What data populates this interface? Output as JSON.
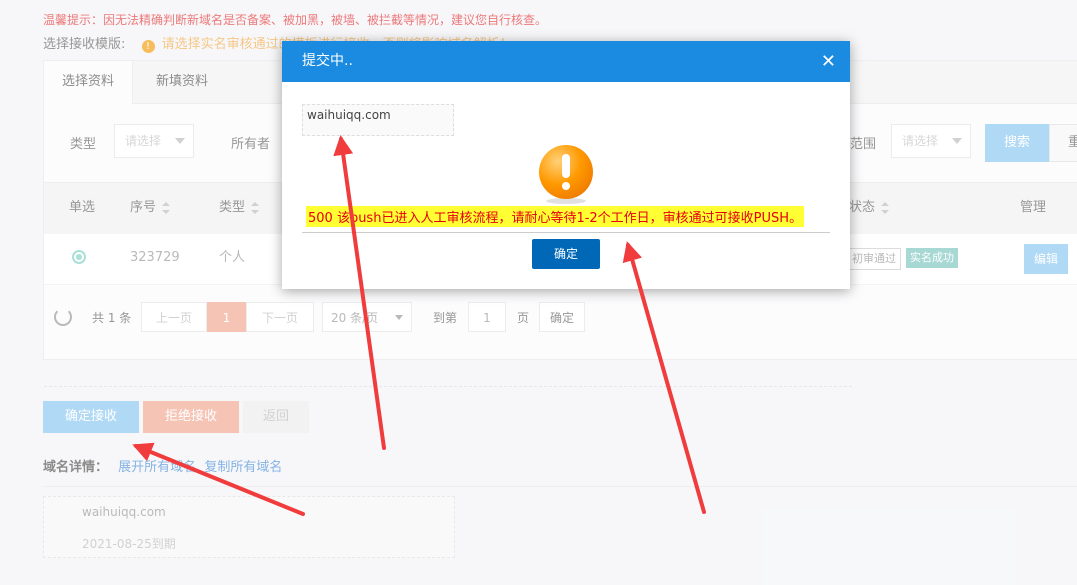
{
  "notice": {
    "tip": "温馨提示：因无法精确判断新域名是否备案、被加黑，被墙、被拦截等情况，建议您自行核查。",
    "template_label": "选择接收模版:",
    "template_warning": "请选择实名审核通过的模板进行接收，否则将影响域名解析！"
  },
  "tabs": [
    {
      "label": "选择资料"
    },
    {
      "label": "新填资料"
    }
  ],
  "filters": {
    "type_label": "类型",
    "type_placeholder": "请选择",
    "owner_label": "所有者",
    "range_label": "范围",
    "range_placeholder": "请选择",
    "search_label": "搜索",
    "reset_label": "重"
  },
  "table": {
    "headers": [
      "单选",
      "序号",
      "类型",
      "状态",
      "管理"
    ],
    "rows": [
      {
        "id": "323729",
        "type": "个人",
        "status1": "初审通过",
        "status2": "实名成功",
        "action": "编辑"
      }
    ]
  },
  "pager": {
    "total": "共 1 条",
    "prev": "上一页",
    "current": "1",
    "next": "下一页",
    "page_size": "20 条/页",
    "goto_label": "到第",
    "goto_value": "1",
    "page_suffix": "页",
    "confirm": "确定"
  },
  "actions": {
    "accept": "确定接收",
    "reject": "拒绝接收",
    "back": "返回"
  },
  "details": {
    "label": "域名详情：",
    "expand_all": "展开所有域名",
    "copy_all": "复制所有域名",
    "domain": "waihuiqq.com",
    "expiry": "2021-08-25到期"
  },
  "modal": {
    "title": "提交中..",
    "close": "✕",
    "domain": "waihuiqq.com",
    "message": "500 该push已进入人工审核流程，请耐心等待1-2个工作日，审核通过可接收PUSH。",
    "ok": "确定"
  },
  "colors": {
    "modal_header": "#1a8be0",
    "primary_button": "#0068b7",
    "accept_button": "#8bc7f2",
    "reject_button": "#f0a893",
    "message_highlight": "#ffff33",
    "message_text": "#e4000f",
    "annotation_arrow": "#f03c3c"
  }
}
